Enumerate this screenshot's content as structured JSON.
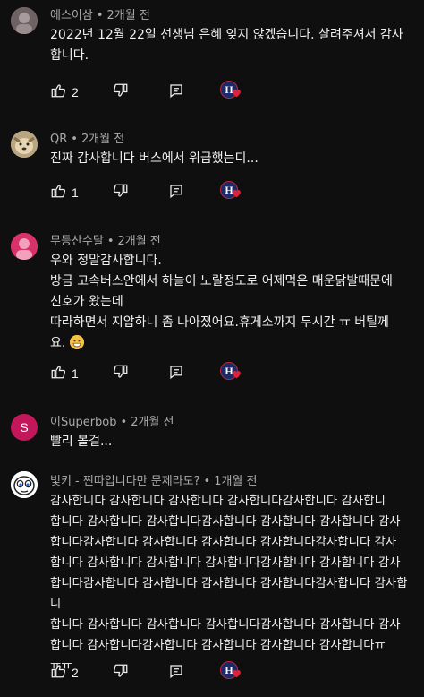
{
  "comments": [
    {
      "author": "에스이삼",
      "time": "2개월 전",
      "text": "2022년 12월 22일 선생님 은혜 잊지 않겠습니다. 살려주셔서 감사\n합니다.",
      "likes": "2",
      "avatar_color": "#8a7a7c",
      "avatar_letter": ""
    },
    {
      "author": "QR",
      "time": "2개월 전",
      "text": "진짜 감사합니다 버스에서 위급했는디...",
      "likes": "1",
      "avatar_color": "#c9b79a",
      "avatar_letter": ""
    },
    {
      "author": "무등산수달",
      "time": "2개월 전",
      "text": "우와 정말감사합니다.\n방금 고속버스안에서 하늘이 노랄정도로  어제먹은 매운닭발때문에\n신호가 왔는데\n따라하면서 지압하니 좀 나아졌어요.휴게소까지 두시간 ㅠ 버틸께\n요.",
      "likes": "1",
      "avatar_color": "#d8326a",
      "avatar_letter": ""
    },
    {
      "author": "이Superbob",
      "time": "2개월 전",
      "text": "빨리 볼걸...",
      "likes": "",
      "avatar_color": "#c2185b",
      "avatar_letter": "S"
    },
    {
      "author": "빛키 - 찐따입니다만 문제라도?",
      "time": "1개월 전",
      "text": "감사합니다 감사합니다 감사합니다 감사합니다감사합니다 감사합니\n합니다 감사합니다 감사합니다감사합니다 감사합니다 감사합니다 감사\n합니다감사합니다 감사합니다 감사합니다 감사합니다감사합니다 감사\n합니다 감사합니다 감사합니다 감사합니다감사합니다 감사합니다 감사\n합니다감사합니다 감사합니다 감사합니다 감사합니다감사합니다 감사합니\n합니다 감사합니다 감사합니다 감사합니다감사합니다 감사합니다 감사\n합니다 감사합니다감사합니다 감사합니다 감사합니다 감사합니다ㅠ\nㅠㅠ",
      "likes": "2",
      "avatar_color": "#ffffff",
      "avatar_letter": ""
    }
  ],
  "icons": {
    "like": "thumbs-up-icon",
    "dislike": "thumbs-down-icon",
    "reply": "reply-icon",
    "creator_heart": "creator-heart-badge"
  },
  "creator_badge_letter": "H",
  "colors": {
    "background": "#0f0f0f",
    "text": "#f1f1f1",
    "meta": "#aaaaaa",
    "heart": "#e0213a"
  }
}
